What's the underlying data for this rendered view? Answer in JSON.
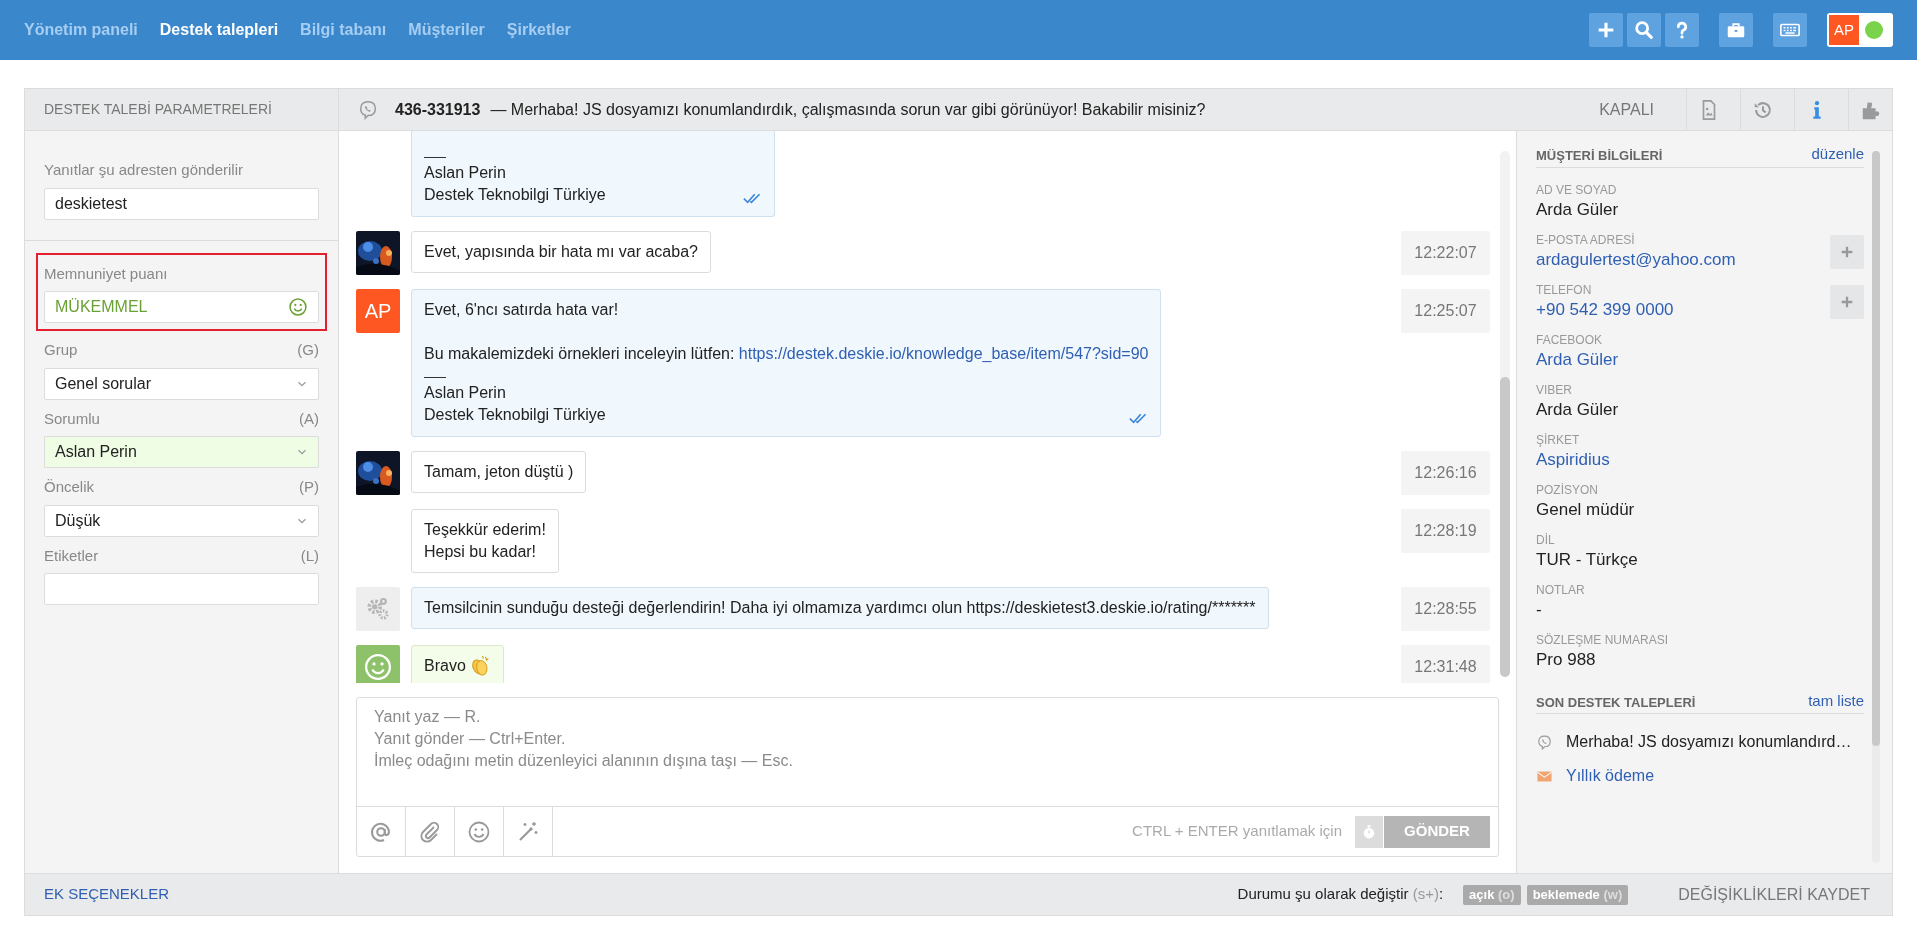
{
  "nav": [
    {
      "label": "Yönetim paneli",
      "selected": false
    },
    {
      "label": "Destek talepleri",
      "selected": true
    },
    {
      "label": "Bilgi tabanı",
      "selected": false
    },
    {
      "label": "Müşteriler",
      "selected": false
    },
    {
      "label": "Şirketler",
      "selected": false
    }
  ],
  "user": {
    "initials": "AP",
    "online": true
  },
  "params_title": "DESTEK TALEBİ PARAMETRELERİ",
  "ticket": {
    "number": "436-331913",
    "subject": "— Merhaba! JS dosyamızı konumlandırdık, çalışmasında sorun var gibi görünüyor! Bakabilir misiniz?",
    "status": "KAPALI"
  },
  "header_tabs": [
    {
      "kind": "document",
      "selected": false
    },
    {
      "kind": "history",
      "selected": false
    },
    {
      "kind": "info",
      "selected": true
    },
    {
      "kind": "puzzle",
      "selected": false
    }
  ],
  "reply_from": {
    "label": "Yanıtlar şu adresten gönderilir",
    "value": "deskietest"
  },
  "satisfaction": {
    "label": "Memnuniyet puanı",
    "value": "MÜKEMMEL",
    "highlighted": true
  },
  "fields": [
    {
      "kind": "select",
      "label": "Grup",
      "shortcut": "(G)",
      "value": "Genel sorular",
      "assigned": false
    },
    {
      "kind": "select",
      "label": "Sorumlu",
      "shortcut": "(A)",
      "value": "Aslan Perin",
      "assigned": true
    },
    {
      "kind": "select",
      "label": "Öncelik",
      "shortcut": "(P)",
      "value": "Düşük",
      "assigned": false
    },
    {
      "kind": "input",
      "label": "Etiketler",
      "shortcut": "(L)",
      "assigned": false
    }
  ],
  "more_options": "EK SEÇENEKLER",
  "messages": [
    {
      "kind": "agent",
      "clipped": true,
      "avatar": false,
      "signature": [
        "Aslan Perin",
        "Destek Teknobilgi Türkiye"
      ],
      "read": true
    },
    {
      "kind": "customer",
      "avatar": true,
      "blocks": [
        {
          "lines": [
            "Evet, yapısında bir hata mı var acaba?"
          ]
        }
      ],
      "time": "12:22:07"
    },
    {
      "kind": "agent",
      "avatar": true,
      "initials": "AP",
      "blocks": [
        {
          "lines": [
            "Evet, 6'ncı satırda hata var!"
          ]
        },
        {
          "lines": [
            "Bu makalemizdeki örnekleri inceleyin lütfen:"
          ],
          "link": "https://destek.deskie.io/knowledge_base/item/547?sid=90"
        }
      ],
      "signature": [
        "Aslan Perin",
        "Destek Teknobilgi Türkiye"
      ],
      "read": true,
      "time": "12:25:07"
    },
    {
      "kind": "customer",
      "avatar": true,
      "blocks": [
        {
          "lines": [
            "Tamam, jeton düştü )"
          ]
        }
      ],
      "time": "12:26:16"
    },
    {
      "kind": "customer",
      "avatar": false,
      "blocks": [
        {
          "lines": [
            "Teşekkür ederim!",
            "Hepsi bu kadar!"
          ]
        }
      ],
      "time": "12:28:19"
    },
    {
      "kind": "system",
      "avatar": true,
      "blocks": [
        {
          "lines": [
            "Temsilcinin sunduğu desteği değerlendirin! Daha iyi olmamıza yardımcı olun https://deskietest3.deskie.io/rating/*******"
          ]
        }
      ],
      "time": "12:28:55"
    },
    {
      "kind": "rating",
      "avatar": true,
      "blocks": [
        {
          "lines": [
            "Bravo"
          ]
        }
      ],
      "clap": true,
      "time": "12:31:48"
    }
  ],
  "composer": {
    "placeholder": "Yanıt yaz — R.\nYanıt gönder — Ctrl+Enter.\nİmleç odağını metin düzenleyici alanının dışına taşı — Esc.",
    "hint": "CTRL + ENTER yanıtlamak için",
    "send": "GÖNDER",
    "disabled": true
  },
  "status_change": {
    "label": "Durumu şu olarak değiştir",
    "shortcut": "(s+)",
    "suffix": ":",
    "options": [
      {
        "label": "açık",
        "shortcut": "(o)"
      },
      {
        "label": "beklemede",
        "shortcut": "(w)"
      }
    ]
  },
  "save": "DEĞİŞİKLİKLERİ KAYDET",
  "customer": {
    "title": "MÜŞTERİ BİLGİLERİ",
    "edit": "düzenle",
    "fields": [
      {
        "label": "AD VE SOYAD",
        "value": "Arda Güler",
        "link": false,
        "addable": false
      },
      {
        "label": "E-POSTA ADRESİ",
        "value": "ardagulertest@yahoo.com",
        "link": true,
        "addable": true
      },
      {
        "label": "TELEFON",
        "value": "+90 542 399 0000",
        "link": true,
        "addable": true
      },
      {
        "label": "FACEBOOK",
        "value": "Arda Güler",
        "link": true,
        "addable": false
      },
      {
        "label": "VIBER",
        "value": "Arda Güler",
        "link": false,
        "addable": false
      },
      {
        "label": "ŞİRKET",
        "value": "Aspiridius",
        "link": true,
        "addable": false
      },
      {
        "label": "POZİSYON",
        "value": "Genel müdür",
        "link": false,
        "addable": false
      },
      {
        "label": "DİL",
        "value": "TUR - Türkçe",
        "link": false,
        "addable": false
      },
      {
        "label": "NOTLAR",
        "value": "-",
        "link": false,
        "addable": false
      },
      {
        "label": "SÖZLEŞME NUMARASI",
        "value": "Pro 988",
        "link": false,
        "addable": false
      }
    ]
  },
  "recent": {
    "title": "SON DESTEK TALEPLERİ",
    "full_list": "tam liste",
    "items": [
      {
        "kind": "viber",
        "text": "Merhaba! JS dosyamızı konumlandırd…",
        "current": true
      },
      {
        "kind": "email",
        "text": "Yıllık ödeme",
        "current": false
      }
    ]
  }
}
